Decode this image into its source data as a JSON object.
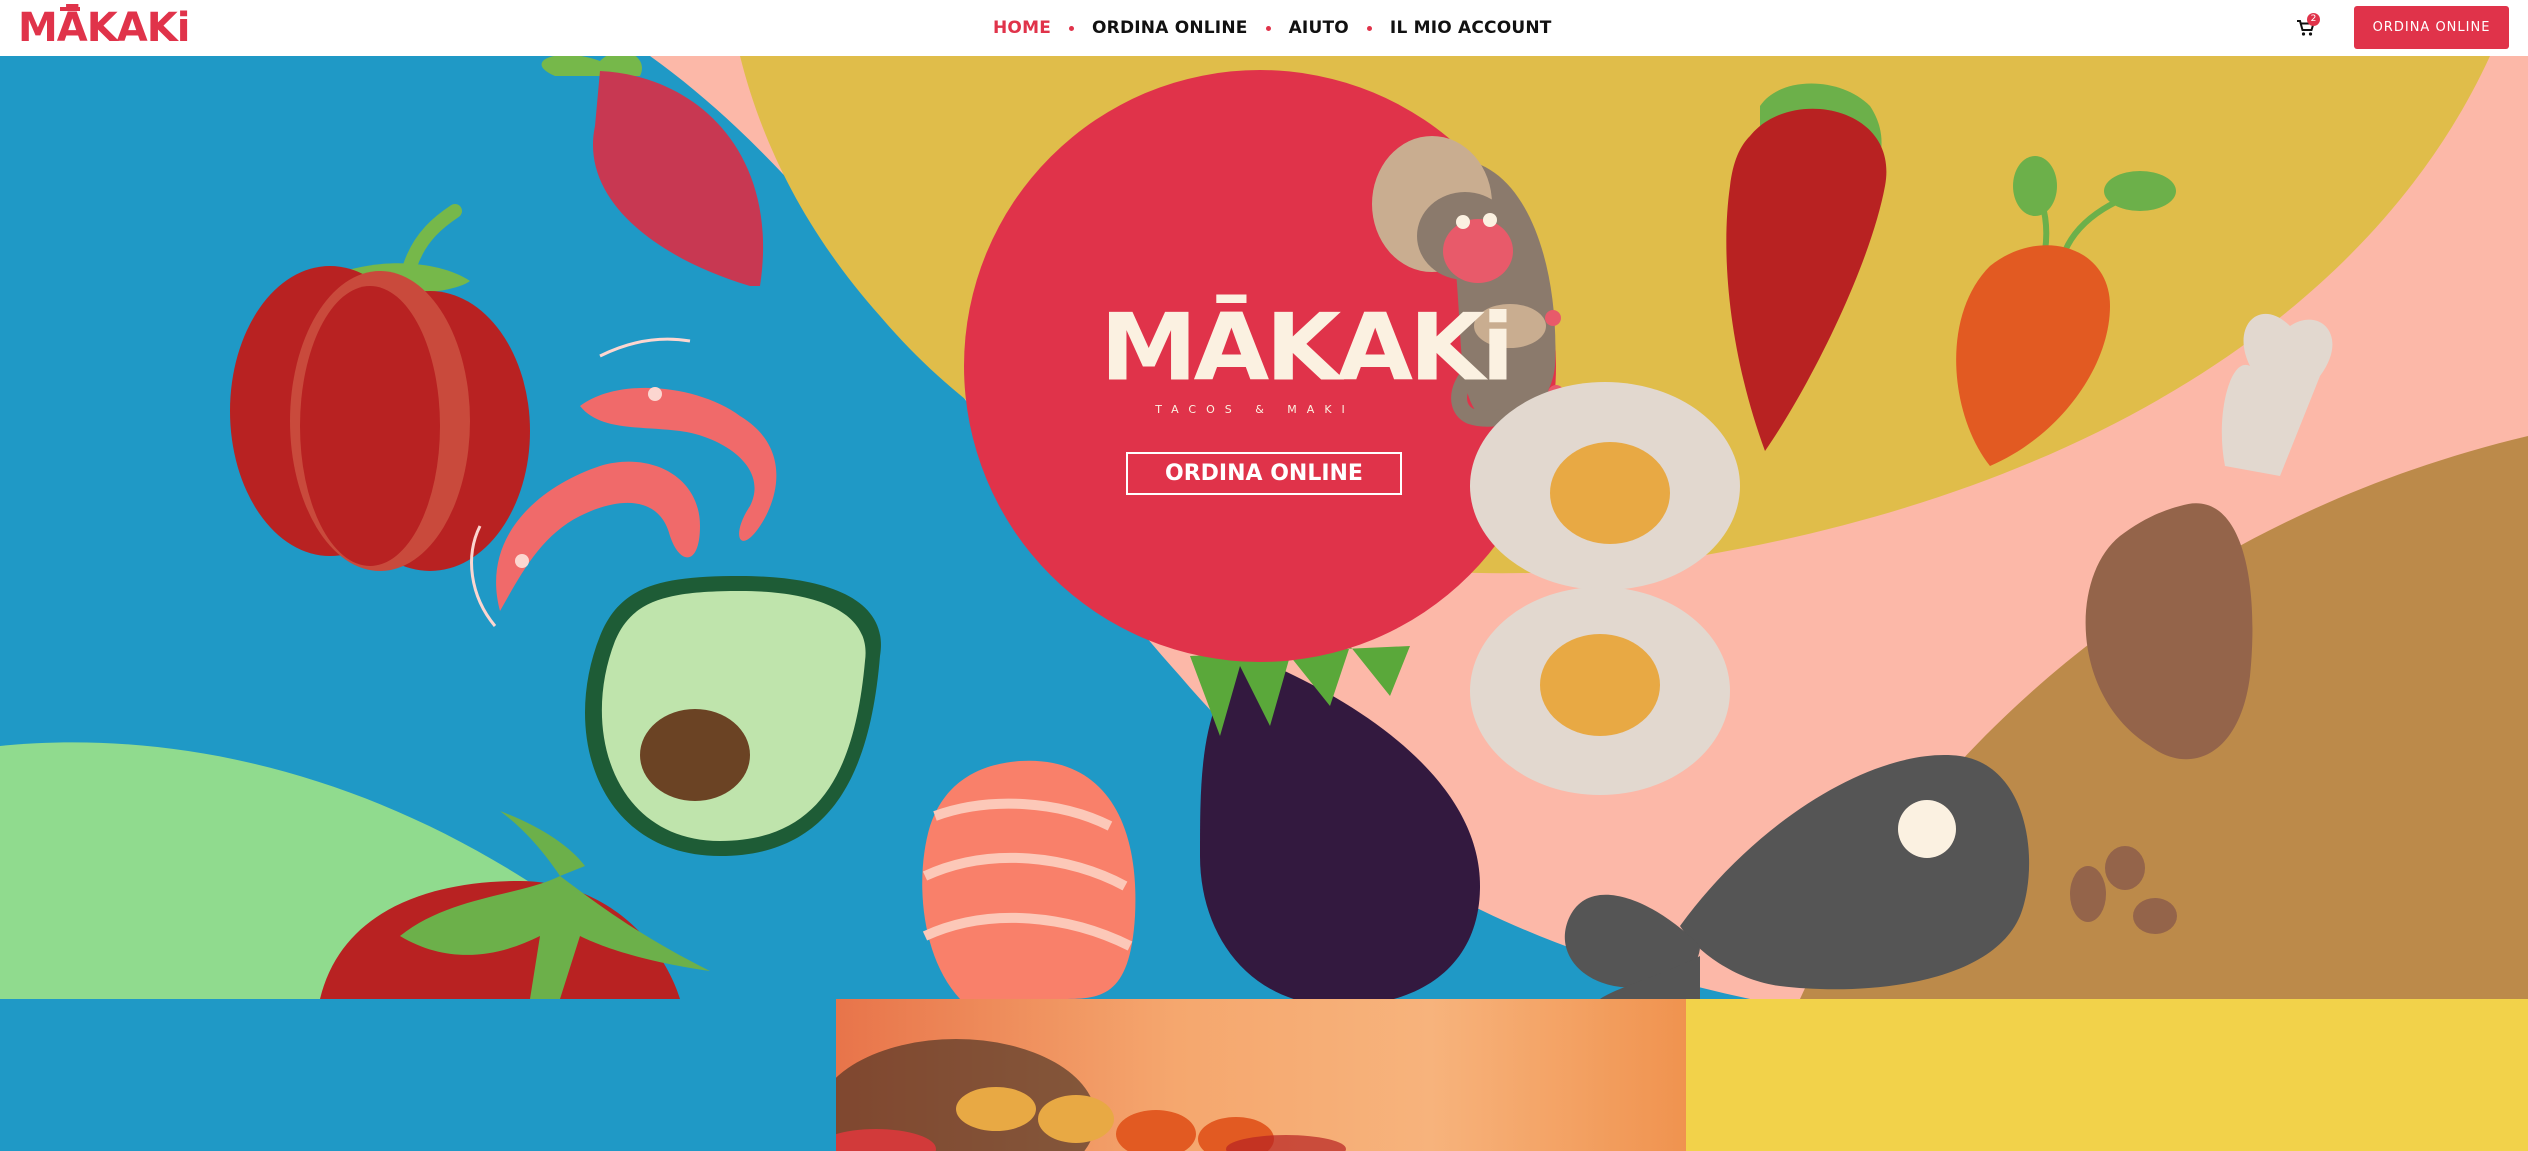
{
  "header": {
    "logo": "MĀKAKi",
    "nav": [
      {
        "label": "HOME",
        "active": true
      },
      {
        "label": "ORDINA ONLINE",
        "active": false
      },
      {
        "label": "AIUTO",
        "active": false
      },
      {
        "label": "IL MIO ACCOUNT",
        "active": false
      }
    ],
    "cart_icon": "shopping-cart-icon",
    "cart_count": "2",
    "order_button": "ORDINA ONLINE"
  },
  "hero": {
    "brand": "MĀKAKi",
    "tagline": "TACOS & MAKI",
    "cta": "ORDINA ONLINE"
  },
  "colors": {
    "accent": "#e0334a",
    "hero_blue": "#1f99c6",
    "mustard": "#e0bd4a",
    "peach": "#fcb8a8",
    "brown": "#bc8a4a",
    "yellow": "#f2d24a",
    "cream": "#fbf1e1"
  }
}
